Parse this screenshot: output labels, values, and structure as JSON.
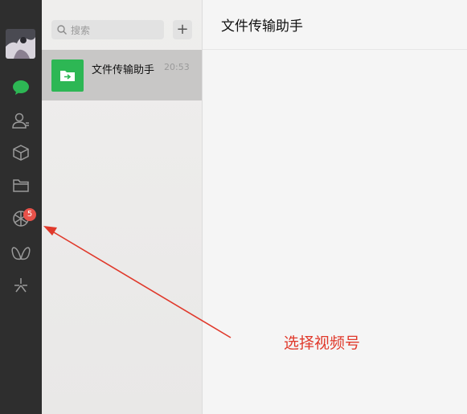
{
  "sidebar": {
    "avatar": "user-avatar",
    "items": [
      {
        "name": "chat-icon",
        "color": "#2db754"
      },
      {
        "name": "contacts-icon"
      },
      {
        "name": "box-icon"
      },
      {
        "name": "folder-icon"
      },
      {
        "name": "channels-icon",
        "badge": "5"
      },
      {
        "name": "butterfly-icon"
      },
      {
        "name": "sparkle-icon"
      }
    ]
  },
  "chat_list": {
    "search_placeholder": "搜索",
    "add_label": "+",
    "items": [
      {
        "name": "文件传输助手",
        "time": "20:53"
      }
    ]
  },
  "main": {
    "title": "文件传输助手"
  },
  "annotation": {
    "text": "选择视频号",
    "color": "#e0392b"
  },
  "colors": {
    "sidebar_bg": "#2e2e2e",
    "accent": "#2db754",
    "badge": "#e8524a"
  }
}
